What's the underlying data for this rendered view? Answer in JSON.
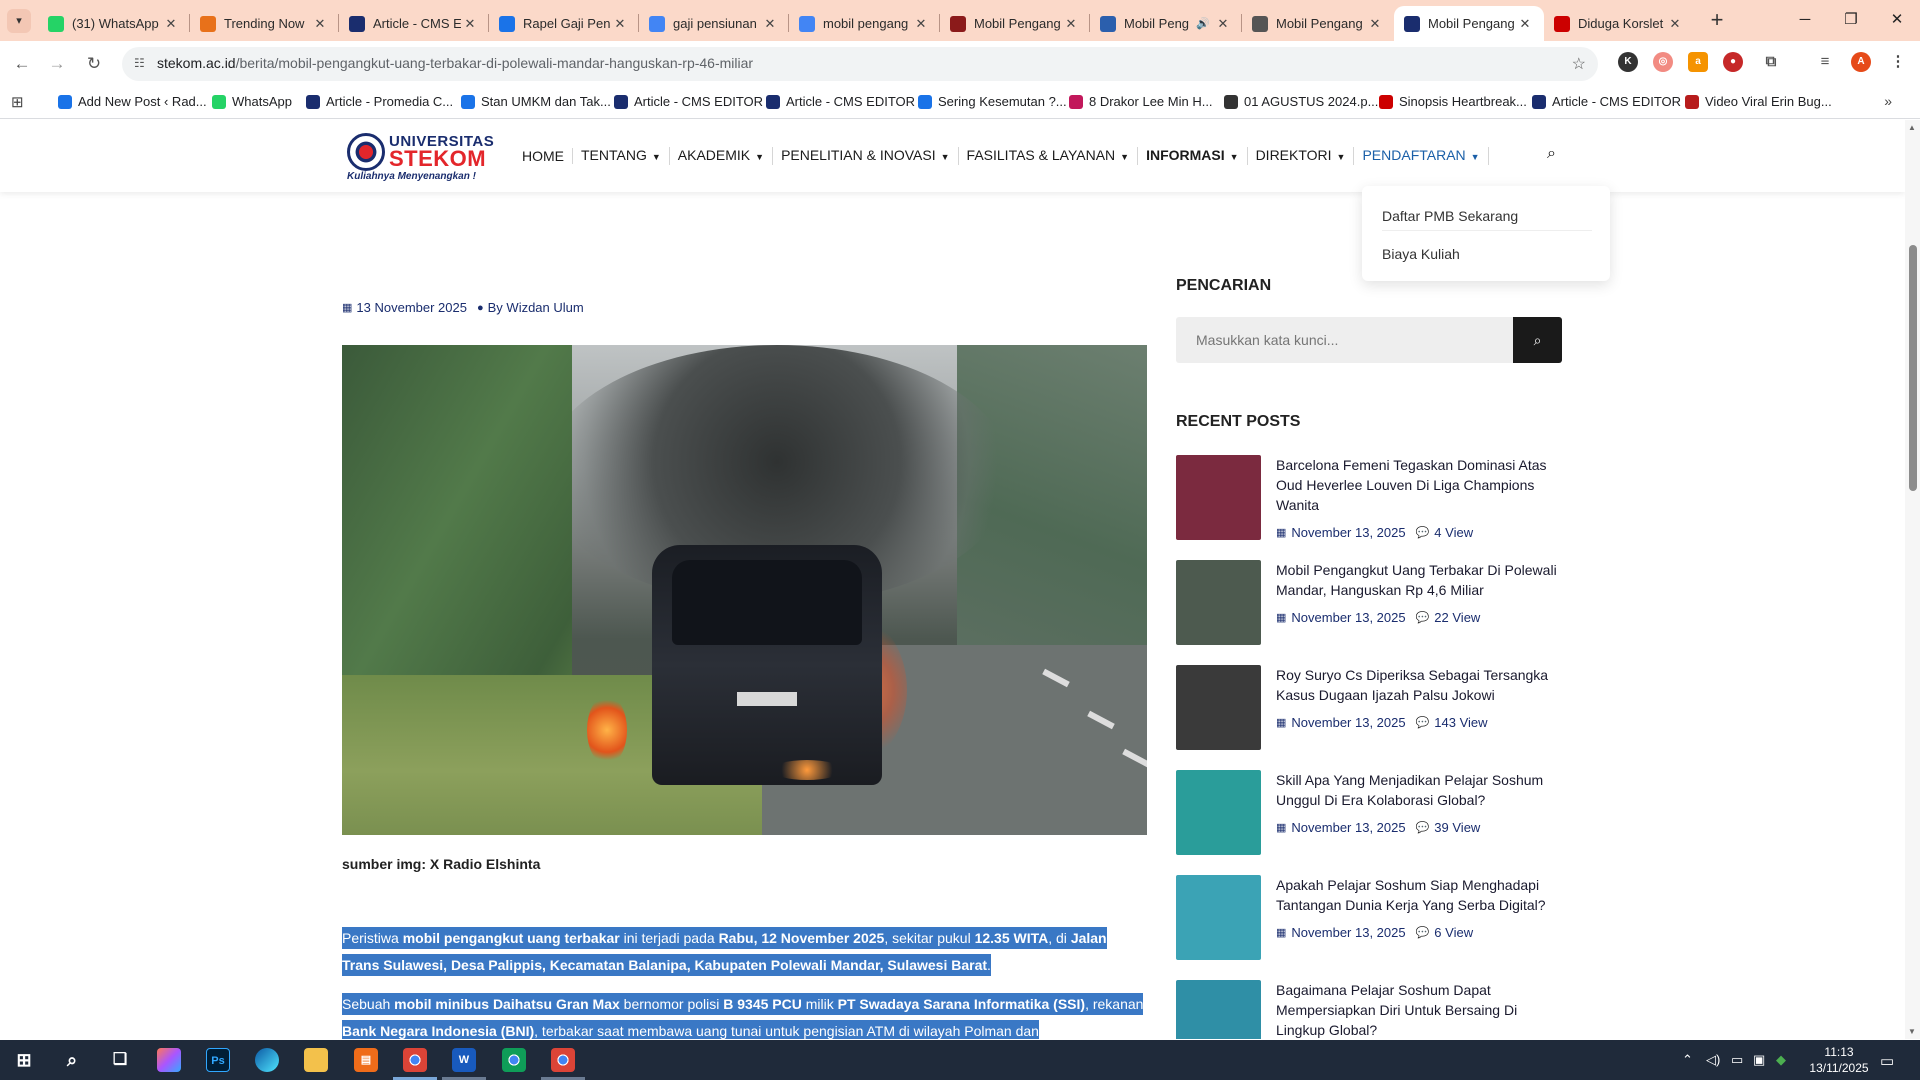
{
  "browser": {
    "tabs": [
      {
        "label": "(31) WhatsApp",
        "favicon": "whatsapp-icon",
        "color": "#25d366"
      },
      {
        "label": "Trending Now",
        "favicon": "trending-icon",
        "color": "#e8711a"
      },
      {
        "label": "Article - CMS E",
        "favicon": "promedia-icon",
        "color": "#1a2d6e"
      },
      {
        "label": "Rapel Gaji Pens",
        "favicon": "news-icon",
        "color": "#1a73e8"
      },
      {
        "label": "gaji pensiunan",
        "favicon": "google-icon",
        "color": "#4285f4"
      },
      {
        "label": "mobil pengang",
        "favicon": "google-icon",
        "color": "#4285f4"
      },
      {
        "label": "Mobil Pengang",
        "favicon": "news-k-icon",
        "color": "#8b1a1a"
      },
      {
        "label": "Mobil Peng",
        "favicon": "radio-icon",
        "color": "#2b5fad",
        "audio": true
      },
      {
        "label": "Mobil Pengang",
        "favicon": "pen-icon",
        "color": "#555"
      },
      {
        "label": "Mobil Pengang",
        "favicon": "stekom-icon",
        "color": "#1a2d6e",
        "active": true
      },
      {
        "label": "Diduga Korslet",
        "favicon": "cnn-icon",
        "color": "#cc0000"
      }
    ],
    "url_host": "stekom.ac.id",
    "url_path": "/berita/mobil-pengangkut-uang-terbakar-di-polewali-mandar-hanguskan-rp-46-miliar",
    "profile_initial": "A",
    "bookmarks": [
      {
        "label": "Add New Post ‹ Rad...",
        "color": "#1a73e8"
      },
      {
        "label": "WhatsApp",
        "color": "#25d366"
      },
      {
        "label": "Article - Promedia C...",
        "color": "#1a2d6e"
      },
      {
        "label": "Stan UMKM dan Tak...",
        "color": "#1a73e8"
      },
      {
        "label": "Article - CMS EDITOR",
        "color": "#1a2d6e"
      },
      {
        "label": "Article - CMS EDITOR",
        "color": "#1a2d6e"
      },
      {
        "label": "Sering Kesemutan ?...",
        "color": "#1a73e8"
      },
      {
        "label": "8 Drakor Lee Min H...",
        "color": "#c2185b"
      },
      {
        "label": "01 AGUSTUS 2024.p...",
        "color": "#333"
      },
      {
        "label": "Sinopsis Heartbreak...",
        "color": "#cc0000"
      },
      {
        "label": "Article - CMS EDITOR",
        "color": "#1a2d6e"
      },
      {
        "label": "Video Viral Erin Bug...",
        "color": "#b71c1c"
      }
    ]
  },
  "site": {
    "logo_top": "UNIVERSITAS",
    "logo_name": "STEKOM",
    "logo_tagline": "Kuliahnya Menyenangkan !",
    "nav": [
      {
        "label": "HOME",
        "caret": false
      },
      {
        "label": "TENTANG",
        "caret": true
      },
      {
        "label": "AKADEMIK",
        "caret": true
      },
      {
        "label": "PENELITIAN & INOVASI",
        "caret": true
      },
      {
        "label": "FASILITAS & LAYANAN",
        "caret": true
      },
      {
        "label": "INFORMASI",
        "caret": true,
        "bold": true
      },
      {
        "label": "DIREKTORI",
        "caret": true
      },
      {
        "label": "PENDAFTARAN",
        "caret": true,
        "highlight": true
      }
    ],
    "dropdown": [
      "Daftar PMB Sekarang",
      "Biaya Kuliah"
    ]
  },
  "article": {
    "date": "13 November 2025",
    "author": "By Wizdan Ulum",
    "caption": "sumber img: X Radio Elshinta",
    "p1": [
      {
        "t": "Peristiwa ",
        "b": false
      },
      {
        "t": "mobil pengangkut uang terbakar",
        "b": true
      },
      {
        "t": " ini terjadi pada ",
        "b": false
      },
      {
        "t": "Rabu, 12 November 2025",
        "b": true
      },
      {
        "t": ", sekitar pukul ",
        "b": false
      },
      {
        "t": "12.35 WITA",
        "b": true
      },
      {
        "t": ", di ",
        "b": false
      },
      {
        "t": "Jalan Trans Sulawesi, Desa Palippis, Kecamatan Balanipa, Kabupaten Polewali Mandar, Sulawesi Barat",
        "b": true
      },
      {
        "t": ".",
        "b": false
      }
    ],
    "p2": [
      {
        "t": "Sebuah ",
        "b": false
      },
      {
        "t": "mobil minibus Daihatsu Gran Max",
        "b": true
      },
      {
        "t": " bernomor polisi ",
        "b": false
      },
      {
        "t": "B 9345 PCU",
        "b": true
      },
      {
        "t": " milik ",
        "b": false
      },
      {
        "t": "PT Swadaya Sarana Informatika (SSI)",
        "b": true
      },
      {
        "t": ", rekanan ",
        "b": false
      },
      {
        "t": "Bank Negara Indonesia (BNI)",
        "b": true
      },
      {
        "t": ", terbakar saat membawa uang tunai untuk pengisian ATM di wilayah Polman dan",
        "b": false
      }
    ],
    "highlight_color": "#3a78c5"
  },
  "sidebar": {
    "search_heading": "PENCARIAN",
    "search_placeholder": "Masukkan kata kunci...",
    "recent_heading": "RECENT POSTS",
    "posts": [
      {
        "title": "Barcelona Femeni Tegaskan Dominasi Atas Oud Heverlee Louven Di Liga Champions Wanita",
        "date": "November 13, 2025",
        "views": "4 View",
        "thumb": "#7b2a3f"
      },
      {
        "title": "Mobil Pengangkut Uang Terbakar Di Polewali Mandar, Hanguskan Rp 4,6 Miliar",
        "date": "November 13, 2025",
        "views": "22 View",
        "thumb": "#4d5a4f"
      },
      {
        "title": "Roy Suryo Cs Diperiksa Sebagai Tersangka Kasus Dugaan Ijazah Palsu Jokowi",
        "date": "November 13, 2025",
        "views": "143 View",
        "thumb": "#3a3a3a"
      },
      {
        "title": "Skill Apa Yang Menjadikan Pelajar Soshum Unggul Di Era Kolaborasi Global?",
        "date": "November 13, 2025",
        "views": "39 View",
        "thumb": "#2a9d9a"
      },
      {
        "title": "Apakah Pelajar Soshum Siap Menghadapi Tantangan Dunia Kerja Yang Serba Digital?",
        "date": "November 13, 2025",
        "views": "6 View",
        "thumb": "#3ba3b5"
      },
      {
        "title": "Bagaimana Pelajar Soshum Dapat Mempersiapkan Diri Untuk Bersaing Di Lingkup Global?",
        "date": "",
        "views": "",
        "thumb": "#2f8fa6"
      }
    ]
  },
  "taskbar": {
    "time": "11:13",
    "date": "13/11/2025"
  }
}
